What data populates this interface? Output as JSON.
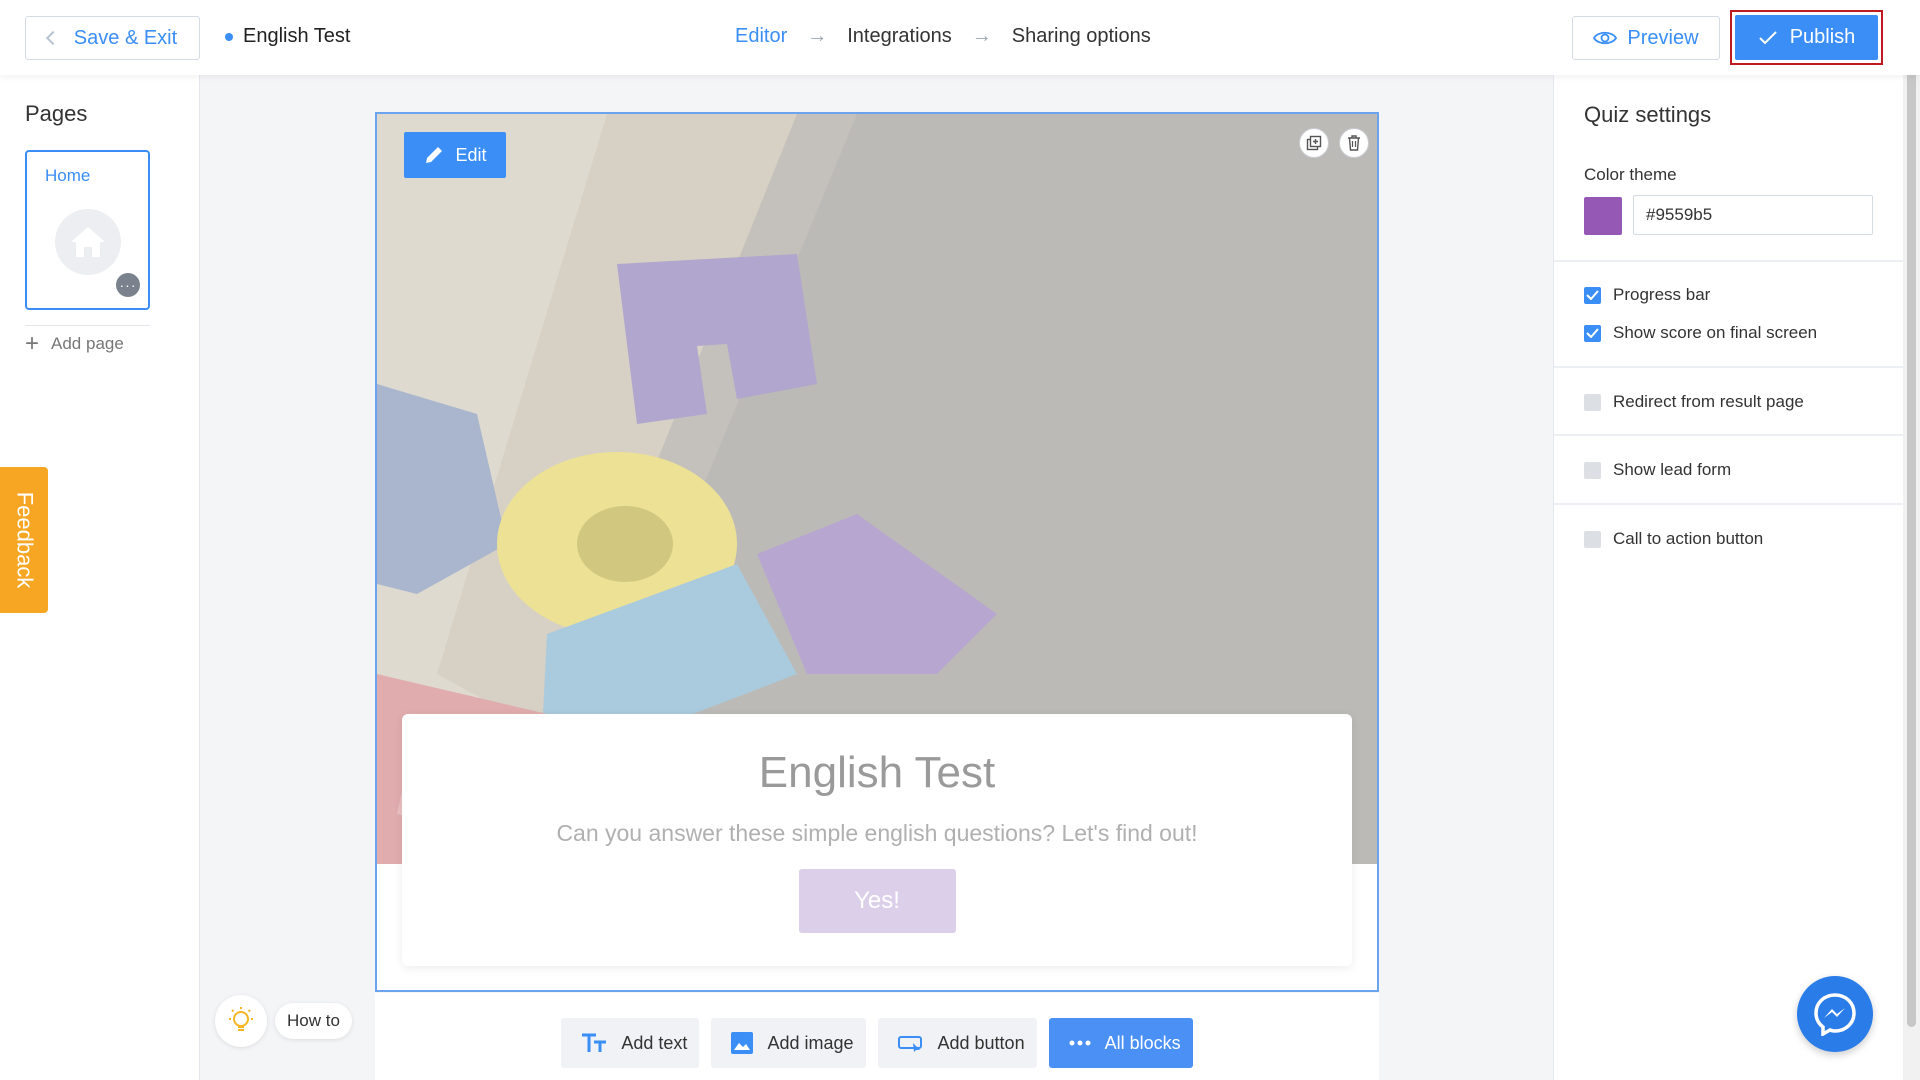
{
  "header": {
    "save_exit_label": "Save & Exit",
    "doc_title": "English Test",
    "steps": [
      {
        "label": "Editor",
        "active": true
      },
      {
        "label": "Integrations",
        "active": false
      },
      {
        "label": "Sharing options",
        "active": false
      }
    ],
    "preview_label": "Preview",
    "publish_label": "Publish"
  },
  "left": {
    "title": "Pages",
    "pages": [
      {
        "label": "Home",
        "icon": "home-icon",
        "more": "···"
      }
    ],
    "add_page_label": "Add page",
    "feedback_label": "Feedback"
  },
  "canvas": {
    "edit_label": "Edit",
    "title": "English Test",
    "subtitle": "Can you answer these simple english questions? Let's find out!",
    "cta_label": "Yes!"
  },
  "toolbar": {
    "add_text": "Add text",
    "add_image": "Add image",
    "add_button": "Add button",
    "all_blocks": "All blocks"
  },
  "howto": {
    "label": "How to"
  },
  "settings": {
    "title": "Quiz settings",
    "color_theme_label": "Color theme",
    "color_value": "#9559b5",
    "options": [
      {
        "label": "Progress bar",
        "checked": true
      },
      {
        "label": "Show score on final screen",
        "checked": true
      },
      {
        "label": "Redirect from result page",
        "checked": false
      },
      {
        "label": "Show lead form",
        "checked": false
      },
      {
        "label": "Call to action button",
        "checked": false
      }
    ]
  },
  "colors": {
    "accent": "#3a8ef6",
    "theme": "#9559b5",
    "feedback": "#f6a623",
    "publish_highlight": "#c0191f"
  }
}
